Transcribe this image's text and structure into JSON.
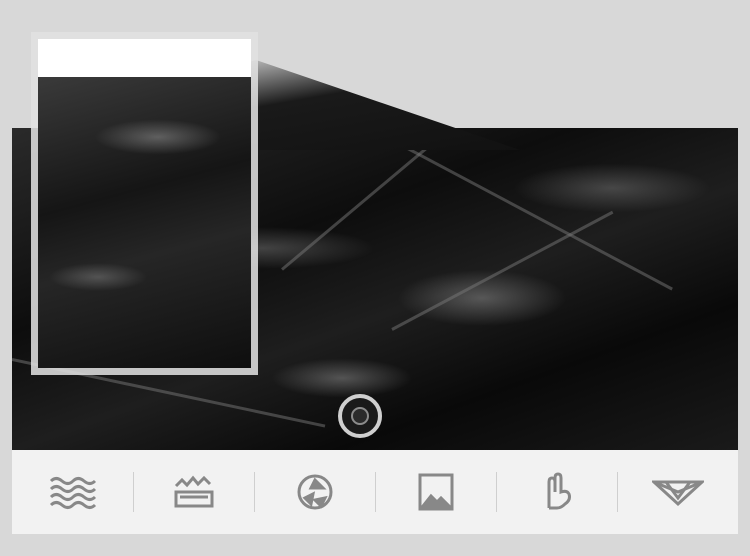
{
  "colors": {
    "background": "#d8d8d8",
    "icon_bar": "#f2f2f2",
    "icon_stroke": "#888888",
    "fabric": "#111111"
  },
  "icons": [
    {
      "name": "waves-icon"
    },
    {
      "name": "windproof-icon"
    },
    {
      "name": "breathable-icon"
    },
    {
      "name": "image-icon"
    },
    {
      "name": "soft-touch-icon"
    },
    {
      "name": "down-fill-icon"
    }
  ]
}
